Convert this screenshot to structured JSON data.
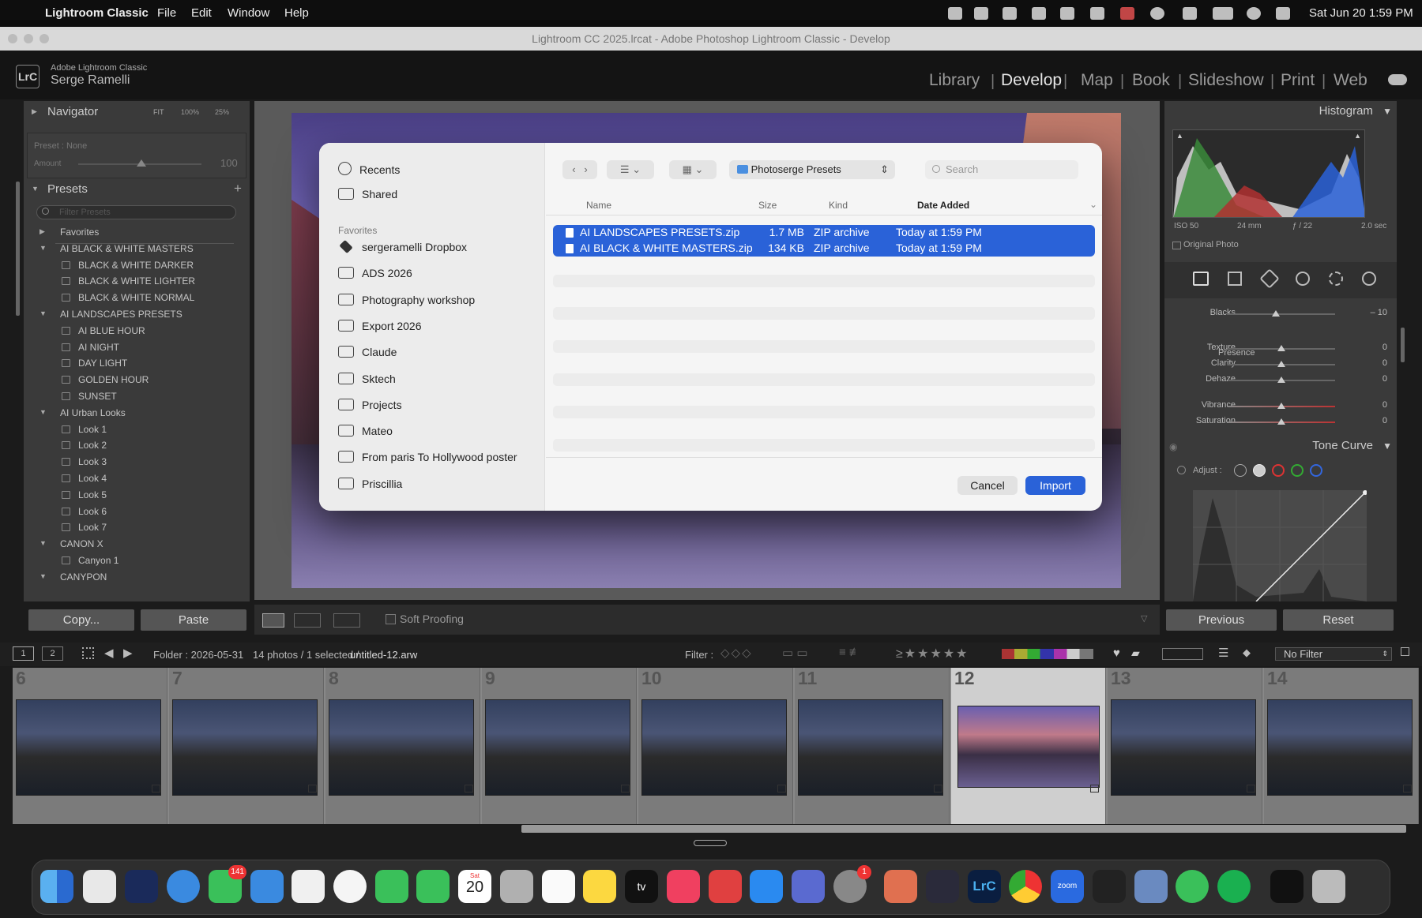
{
  "menubar": {
    "app_name": "Lightroom Classic",
    "items": [
      "File",
      "Edit",
      "Window",
      "Help"
    ],
    "clock": "Sat Jun 20  1:59 PM"
  },
  "window": {
    "title": "Lightroom CC 2025.lrcat - Adobe Photoshop Lightroom Classic - Develop"
  },
  "identity": {
    "logo": "LrC",
    "app_label": "Adobe Lightroom Classic",
    "user": "Serge Ramelli",
    "modules": [
      "Library",
      "Develop",
      "Map",
      "Book",
      "Slideshow",
      "Print",
      "Web"
    ],
    "active_module": "Develop"
  },
  "left": {
    "navigator": {
      "label": "Navigator",
      "zoom": [
        "FIT",
        "100%",
        "25%"
      ]
    },
    "preset_amount": {
      "preset_label": "Preset : None",
      "amount_label": "Amount",
      "amount_value": "100"
    },
    "presets": {
      "label": "Presets",
      "filter_placeholder": "Filter Presets",
      "tree": [
        {
          "t": "group",
          "label": "Favorites",
          "open": false
        },
        {
          "t": "group",
          "label": "AI BLACK & WHITE MASTERS",
          "open": true
        },
        {
          "t": "item",
          "label": "BLACK & WHITE DARKER"
        },
        {
          "t": "item",
          "label": "BLACK & WHITE LIGHTER"
        },
        {
          "t": "item",
          "label": "BLACK & WHITE NORMAL"
        },
        {
          "t": "group",
          "label": "AI LANDSCAPES PRESETS",
          "open": true
        },
        {
          "t": "item",
          "label": "AI BLUE HOUR"
        },
        {
          "t": "item",
          "label": "AI NIGHT"
        },
        {
          "t": "item",
          "label": "DAY LIGHT"
        },
        {
          "t": "item",
          "label": "GOLDEN HOUR"
        },
        {
          "t": "item",
          "label": "SUNSET"
        },
        {
          "t": "group",
          "label": "AI Urban Looks",
          "open": true
        },
        {
          "t": "item",
          "label": "Look 1"
        },
        {
          "t": "item",
          "label": "Look 2"
        },
        {
          "t": "item",
          "label": "Look 3"
        },
        {
          "t": "item",
          "label": "Look 4"
        },
        {
          "t": "item",
          "label": "Look 5"
        },
        {
          "t": "item",
          "label": "Look 6"
        },
        {
          "t": "item",
          "label": "Look 7"
        },
        {
          "t": "group",
          "label": "CANON X",
          "open": true
        },
        {
          "t": "item",
          "label": "Canyon 1"
        },
        {
          "t": "group",
          "label": "CANYPON",
          "open": true
        }
      ]
    },
    "copy_label": "Copy...",
    "paste_label": "Paste"
  },
  "toolbar": {
    "soft_proofing": "Soft Proofing"
  },
  "right": {
    "histogram": {
      "label": "Histogram",
      "iso": "ISO 50",
      "focal": "24 mm",
      "aperture": "ƒ / 22",
      "shutter": "2.0 sec",
      "original_photo": "Original Photo"
    },
    "sliders": [
      {
        "label": "Blacks",
        "value": "– 10",
        "pos": 0.45
      },
      {
        "label": "Texture",
        "value": "0",
        "pos": 0.5
      },
      {
        "label": "Clarity",
        "value": "0",
        "pos": 0.5
      },
      {
        "label": "Dehaze",
        "value": "0",
        "pos": 0.5
      },
      {
        "label": "Vibrance",
        "value": "0",
        "pos": 0.5
      },
      {
        "label": "Saturation",
        "value": "0",
        "pos": 0.5
      }
    ],
    "presence_label": "Presence",
    "tone_curve": {
      "label": "Tone Curve",
      "adjust": "Adjust :"
    },
    "previous_label": "Previous",
    "reset_label": "Reset"
  },
  "dialog": {
    "sidebar": {
      "top": [
        {
          "label": "Recents",
          "icon": "clock-icon"
        },
        {
          "label": "Shared",
          "icon": "shared-folder-icon"
        }
      ],
      "favorites_label": "Favorites",
      "favorites": [
        "sergeramelli Dropbox",
        "ADS 2026",
        "Photography workshop",
        "Export 2026",
        "Claude",
        "Sktech",
        "Projects",
        "Mateo",
        "From paris To Hollywood poster",
        "Priscillia"
      ]
    },
    "location": "Photoserge Presets",
    "search_placeholder": "Search",
    "columns": {
      "name": "Name",
      "size": "Size",
      "kind": "Kind",
      "date": "Date Added"
    },
    "files": [
      {
        "name": "AI LANDSCAPES PRESETS.zip",
        "size": "1.7 MB",
        "kind": "ZIP archive",
        "date": "Today at 1:59 PM"
      },
      {
        "name": "AI BLACK & WHITE MASTERS.zip",
        "size": "134 KB",
        "kind": "ZIP archive",
        "date": "Today at 1:59 PM"
      }
    ],
    "cancel_label": "Cancel",
    "import_label": "Import"
  },
  "filmstrip": {
    "folder": "Folder : 2026-05-31",
    "count": "14 photos / 1 selected /",
    "file": "untitled-12.arw",
    "filter_label": "Filter :",
    "no_filter": "No Filter",
    "pages": [
      "1",
      "2"
    ],
    "cells": [
      {
        "n": "6"
      },
      {
        "n": "7"
      },
      {
        "n": "8"
      },
      {
        "n": "9"
      },
      {
        "n": "10"
      },
      {
        "n": "11"
      },
      {
        "n": "12",
        "selected": true
      },
      {
        "n": "13"
      },
      {
        "n": "14"
      }
    ]
  },
  "dock": {
    "messages_badge": "141",
    "settings_badge": "1",
    "calendar_month": "Sat",
    "calendar_day": "20",
    "zoom_label": "zoom",
    "lrc_label": "LrC",
    "tv_label": "tv"
  },
  "colors": {
    "accent": "#2a62d8",
    "panel": "#3a3a3a",
    "dialog": "#f5f5f5"
  }
}
